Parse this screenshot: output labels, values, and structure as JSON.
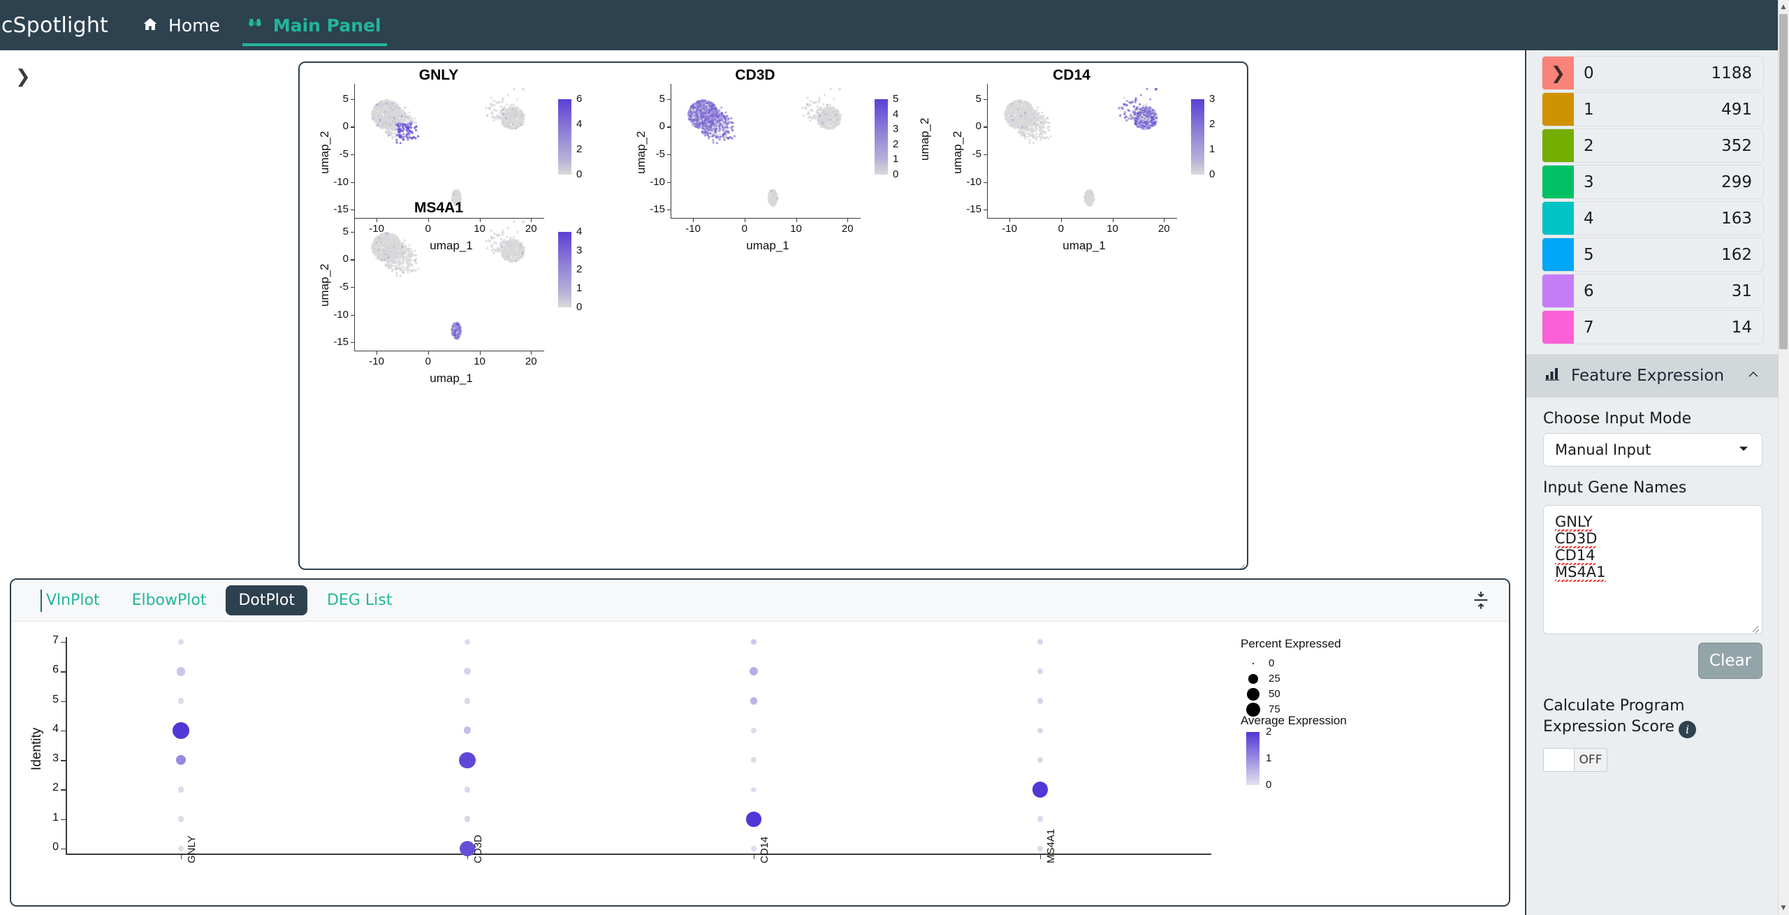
{
  "navbar": {
    "brand": "scSpotlight",
    "items": [
      {
        "label": "Home",
        "icon": "home-icon",
        "active": false
      },
      {
        "label": "Main Panel",
        "icon": "binoculars-icon",
        "active": true
      }
    ],
    "background": "#2d414f",
    "accent": "#22b79a"
  },
  "left_expander": {
    "icon": "chevron-right-icon"
  },
  "umap_panels": {
    "chart_data": [
      {
        "type": "scatter",
        "title": "GNLY",
        "xlabel": "umap_1",
        "ylabel": "umap_2",
        "xticks": [
          "-10",
          "0",
          "10",
          "20"
        ],
        "yticks": [
          "5",
          "0",
          "-5",
          "-10",
          "-15"
        ],
        "xlim": [
          -13,
          22
        ],
        "ylim": [
          -16,
          7
        ],
        "colorbar": {
          "label": "",
          "ticks": [
            "6",
            "4",
            "2",
            "0"
          ],
          "min": 0,
          "max": 6,
          "low": "#d9d9d9",
          "high": "#5b3fd6"
        },
        "high_expression_region": "left-cluster-lower-tip"
      },
      {
        "type": "scatter",
        "title": "CD3D",
        "xlabel": "umap_1",
        "ylabel": "umap_2",
        "xticks": [
          "-10",
          "0",
          "10",
          "20"
        ],
        "yticks": [
          "5",
          "0",
          "-5",
          "-10",
          "-15"
        ],
        "xlim": [
          -13,
          22
        ],
        "ylim": [
          -16,
          7
        ],
        "colorbar": {
          "label": "umap_2",
          "ticks": [
            "5",
            "4",
            "3",
            "2",
            "1",
            "0"
          ],
          "min": 0,
          "max": 5,
          "low": "#d9d9d9",
          "high": "#5b3fd6"
        },
        "high_expression_region": "left-cluster"
      },
      {
        "type": "scatter",
        "title": "CD14",
        "xlabel": "umap_1",
        "ylabel": "umap_2",
        "xticks": [
          "-10",
          "0",
          "10",
          "20"
        ],
        "yticks": [
          "5",
          "0",
          "-5",
          "-10",
          "-15"
        ],
        "xlim": [
          -13,
          22
        ],
        "ylim": [
          -16,
          7
        ],
        "colorbar": {
          "label": "",
          "ticks": [
            "3",
            "2",
            "1",
            "0"
          ],
          "min": 0,
          "max": 3,
          "low": "#d9d9d9",
          "high": "#5b3fd6"
        },
        "high_expression_region": "right-cluster"
      },
      {
        "type": "scatter",
        "title": "MS4A1",
        "xlabel": "umap_1",
        "ylabel": "umap_2",
        "xticks": [
          "-10",
          "0",
          "10",
          "20"
        ],
        "yticks": [
          "5",
          "0",
          "-5",
          "-10",
          "-15"
        ],
        "xlim": [
          -13,
          22
        ],
        "ylim": [
          -16,
          7
        ],
        "colorbar": {
          "label": "",
          "ticks": [
            "4",
            "3",
            "2",
            "1",
            "0"
          ],
          "min": 0,
          "max": 4,
          "low": "#d9d9d9",
          "high": "#5b3fd6"
        },
        "high_expression_region": "bottom-cluster"
      }
    ]
  },
  "bottom_panel": {
    "tabs": [
      {
        "label": "VlnPlot",
        "active": false
      },
      {
        "label": "ElbowPlot",
        "active": false
      },
      {
        "label": "DotPlot",
        "active": true
      },
      {
        "label": "DEG List",
        "active": false
      }
    ],
    "collapse_icon": "collapse-vertical-icon",
    "chart_data": {
      "type": "scatter",
      "title": "",
      "xlabel": "",
      "ylabel": "Identity",
      "categories": [
        "GNLY",
        "CD3D",
        "CD14",
        "MS4A1"
      ],
      "identities": [
        "0",
        "1",
        "2",
        "3",
        "4",
        "5",
        "6",
        "7"
      ],
      "legend_position": "right",
      "legends": {
        "size": {
          "title": "Percent Expressed",
          "values": [
            0,
            25,
            50,
            75
          ]
        },
        "color": {
          "title": "Average Expression",
          "ticks": [
            "2",
            "1",
            "0"
          ],
          "min": 0,
          "max": 2,
          "low": "#e6e2ee",
          "high": "#5b3fd6"
        }
      },
      "points": [
        {
          "gene": "GNLY",
          "identity": 0,
          "pct": 4,
          "avg": 0.05
        },
        {
          "gene": "GNLY",
          "identity": 1,
          "pct": 5,
          "avg": 0.08
        },
        {
          "gene": "GNLY",
          "identity": 2,
          "pct": 5,
          "avg": 0.1
        },
        {
          "gene": "GNLY",
          "identity": 3,
          "pct": 22,
          "avg": 1.05
        },
        {
          "gene": "GNLY",
          "identity": 4,
          "pct": 72,
          "avg": 2.0
        },
        {
          "gene": "GNLY",
          "identity": 5,
          "pct": 5,
          "avg": 0.12
        },
        {
          "gene": "GNLY",
          "identity": 6,
          "pct": 15,
          "avg": 0.35
        },
        {
          "gene": "GNLY",
          "identity": 7,
          "pct": 4,
          "avg": 0.1
        },
        {
          "gene": "CD3D",
          "identity": 0,
          "pct": 62,
          "avg": 1.72
        },
        {
          "gene": "CD3D",
          "identity": 1,
          "pct": 6,
          "avg": 0.15
        },
        {
          "gene": "CD3D",
          "identity": 2,
          "pct": 5,
          "avg": 0.12
        },
        {
          "gene": "CD3D",
          "identity": 3,
          "pct": 66,
          "avg": 1.8
        },
        {
          "gene": "CD3D",
          "identity": 4,
          "pct": 10,
          "avg": 0.42
        },
        {
          "gene": "CD3D",
          "identity": 5,
          "pct": 6,
          "avg": 0.14
        },
        {
          "gene": "CD3D",
          "identity": 6,
          "pct": 8,
          "avg": 0.2
        },
        {
          "gene": "CD3D",
          "identity": 7,
          "pct": 4,
          "avg": 0.1
        },
        {
          "gene": "CD14",
          "identity": 0,
          "pct": 5,
          "avg": 0.08
        },
        {
          "gene": "CD14",
          "identity": 1,
          "pct": 56,
          "avg": 2.0
        },
        {
          "gene": "CD14",
          "identity": 2,
          "pct": 4,
          "avg": 0.08
        },
        {
          "gene": "CD14",
          "identity": 3,
          "pct": 4,
          "avg": 0.08
        },
        {
          "gene": "CD14",
          "identity": 4,
          "pct": 4,
          "avg": 0.08
        },
        {
          "gene": "CD14",
          "identity": 5,
          "pct": 10,
          "avg": 0.55
        },
        {
          "gene": "CD14",
          "identity": 6,
          "pct": 14,
          "avg": 0.62
        },
        {
          "gene": "CD14",
          "identity": 7,
          "pct": 6,
          "avg": 0.3
        },
        {
          "gene": "MS4A1",
          "identity": 0,
          "pct": 5,
          "avg": 0.12
        },
        {
          "gene": "MS4A1",
          "identity": 1,
          "pct": 5,
          "avg": 0.12
        },
        {
          "gene": "MS4A1",
          "identity": 2,
          "pct": 60,
          "avg": 2.0
        },
        {
          "gene": "MS4A1",
          "identity": 3,
          "pct": 5,
          "avg": 0.14
        },
        {
          "gene": "MS4A1",
          "identity": 4,
          "pct": 5,
          "avg": 0.14
        },
        {
          "gene": "MS4A1",
          "identity": 5,
          "pct": 6,
          "avg": 0.16
        },
        {
          "gene": "MS4A1",
          "identity": 6,
          "pct": 5,
          "avg": 0.16
        },
        {
          "gene": "MS4A1",
          "identity": 7,
          "pct": 5,
          "avg": 0.16
        }
      ]
    }
  },
  "sidebar": {
    "clusters": [
      {
        "id": "0",
        "count": "1188",
        "color": "#f98279",
        "has_chevron": true
      },
      {
        "id": "1",
        "count": "491",
        "color": "#cf9200",
        "has_chevron": false
      },
      {
        "id": "2",
        "count": "352",
        "color": "#74ae00",
        "has_chevron": false
      },
      {
        "id": "3",
        "count": "299",
        "color": "#00c065",
        "has_chevron": false
      },
      {
        "id": "4",
        "count": "163",
        "color": "#00c3c4",
        "has_chevron": false
      },
      {
        "id": "5",
        "count": "162",
        "color": "#00a6f7",
        "has_chevron": false
      },
      {
        "id": "6",
        "count": "31",
        "color": "#c67cf6",
        "has_chevron": false
      },
      {
        "id": "7",
        "count": "14",
        "color": "#fb61d7",
        "has_chevron": false
      }
    ],
    "feature_expression": {
      "section_title": "Feature Expression",
      "section_icon": "bar-chart-icon",
      "collapse_icon": "chevron-up-icon",
      "input_mode_label": "Choose Input Mode",
      "input_mode_value": "Manual Input",
      "gene_names_label": "Input Gene Names",
      "gene_names": [
        "GNLY",
        "CD3D",
        "CD14",
        "MS4A1"
      ],
      "clear_label": "Clear",
      "score_label": "Calculate Program Expression Score",
      "info_icon": "info-icon",
      "toggle_state": "OFF"
    }
  }
}
